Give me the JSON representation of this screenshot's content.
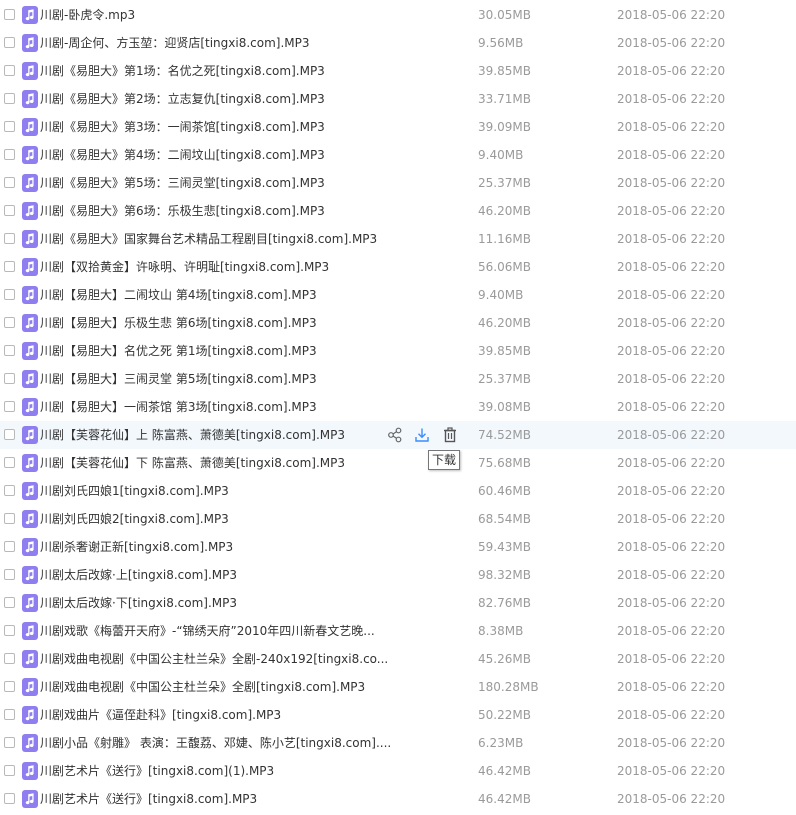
{
  "colors": {
    "file_icon": "#8f7ef0",
    "hover_row": "#f3f8fd",
    "muted_text": "#9a9a9a",
    "accent": "#3b8cff"
  },
  "files": [
    {
      "name": "川剧-卧虎令.mp3",
      "size": "30.05MB",
      "date": "2018-05-06 22:20",
      "icon": "music-file-icon"
    },
    {
      "name": "川剧-周企何、方玉堃：迎贤店[tingxi8.com].MP3",
      "size": "9.56MB",
      "date": "2018-05-06 22:20",
      "icon": "music-file-icon"
    },
    {
      "name": "川剧《易胆大》第1场：名优之死[tingxi8.com].MP3",
      "size": "39.85MB",
      "date": "2018-05-06 22:20",
      "icon": "music-file-icon"
    },
    {
      "name": "川剧《易胆大》第2场：立志复仇[tingxi8.com].MP3",
      "size": "33.71MB",
      "date": "2018-05-06 22:20",
      "icon": "music-file-icon"
    },
    {
      "name": "川剧《易胆大》第3场：一闹茶馆[tingxi8.com].MP3",
      "size": "39.09MB",
      "date": "2018-05-06 22:20",
      "icon": "music-file-icon"
    },
    {
      "name": "川剧《易胆大》第4场：二闹坟山[tingxi8.com].MP3",
      "size": "9.40MB",
      "date": "2018-05-06 22:20",
      "icon": "music-file-icon"
    },
    {
      "name": "川剧《易胆大》第5场：三闹灵堂[tingxi8.com].MP3",
      "size": "25.37MB",
      "date": "2018-05-06 22:20",
      "icon": "music-file-icon"
    },
    {
      "name": "川剧《易胆大》第6场：乐极生悲[tingxi8.com].MP3",
      "size": "46.20MB",
      "date": "2018-05-06 22:20",
      "icon": "music-file-icon"
    },
    {
      "name": "川剧《易胆大》国家舞台艺术精品工程剧目[tingxi8.com].MP3",
      "size": "11.16MB",
      "date": "2018-05-06 22:20",
      "icon": "music-file-icon"
    },
    {
      "name": "川剧【双拾黄金】许咏明、许明耻[tingxi8.com].MP3",
      "size": "56.06MB",
      "date": "2018-05-06 22:20",
      "icon": "music-file-icon"
    },
    {
      "name": "川剧【易胆大】二闹坟山 第4场[tingxi8.com].MP3",
      "size": "9.40MB",
      "date": "2018-05-06 22:20",
      "icon": "music-file-icon"
    },
    {
      "name": "川剧【易胆大】乐极生悲 第6场[tingxi8.com].MP3",
      "size": "46.20MB",
      "date": "2018-05-06 22:20",
      "icon": "music-file-icon"
    },
    {
      "name": "川剧【易胆大】名优之死 第1场[tingxi8.com].MP3",
      "size": "39.85MB",
      "date": "2018-05-06 22:20",
      "icon": "music-file-icon"
    },
    {
      "name": "川剧【易胆大】三闹灵堂 第5场[tingxi8.com].MP3",
      "size": "25.37MB",
      "date": "2018-05-06 22:20",
      "icon": "music-file-icon"
    },
    {
      "name": "川剧【易胆大】一闹茶馆 第3场[tingxi8.com].MP3",
      "size": "39.08MB",
      "date": "2018-05-06 22:20",
      "icon": "music-file-icon"
    },
    {
      "name": "川剧【芙蓉花仙】上 陈富燕、萧德美[tingxi8.com].MP3",
      "size": "74.52MB",
      "date": "2018-05-06 22:20",
      "icon": "music-file-icon"
    },
    {
      "name": "川剧【芙蓉花仙】下 陈富燕、萧德美[tingxi8.com].MP3",
      "size": "75.68MB",
      "date": "2018-05-06 22:20",
      "icon": "music-file-icon"
    },
    {
      "name": "川剧刘氏四娘1[tingxi8.com].MP3",
      "size": "60.46MB",
      "date": "2018-05-06 22:20",
      "icon": "music-file-icon"
    },
    {
      "name": "川剧刘氏四娘2[tingxi8.com].MP3",
      "size": "68.54MB",
      "date": "2018-05-06 22:20",
      "icon": "music-file-icon"
    },
    {
      "name": "川剧杀奢谢正新[tingxi8.com].MP3",
      "size": "59.43MB",
      "date": "2018-05-06 22:20",
      "icon": "music-file-icon"
    },
    {
      "name": "川剧太后改嫁·上[tingxi8.com].MP3",
      "size": "98.32MB",
      "date": "2018-05-06 22:20",
      "icon": "music-file-icon"
    },
    {
      "name": "川剧太后改嫁·下[tingxi8.com].MP3",
      "size": "82.76MB",
      "date": "2018-05-06 22:20",
      "icon": "music-file-icon"
    },
    {
      "name": "川剧戏歌《梅蕾开天府》-“锦绣天府”2010年四川新春文艺晚...",
      "size": "8.38MB",
      "date": "2018-05-06 22:20",
      "icon": "music-file-icon"
    },
    {
      "name": "川剧戏曲电视剧《中国公主杜兰朵》全剧-240x192[tingxi8.co...",
      "size": "45.26MB",
      "date": "2018-05-06 22:20",
      "icon": "music-file-icon"
    },
    {
      "name": "川剧戏曲电视剧《中国公主杜兰朵》全剧[tingxi8.com].MP3",
      "size": "180.28MB",
      "date": "2018-05-06 22:20",
      "icon": "music-file-icon"
    },
    {
      "name": "川剧戏曲片《逼侄赴科》[tingxi8.com].MP3",
      "size": "50.22MB",
      "date": "2018-05-06 22:20",
      "icon": "music-file-icon"
    },
    {
      "name": "川剧小品《射雕》 表演：王馥荔、邓婕、陈小艺[tingxi8.com]....",
      "size": "6.23MB",
      "date": "2018-05-06 22:20",
      "icon": "music-file-icon"
    },
    {
      "name": "川剧艺术片《送行》[tingxi8.com](1).MP3",
      "size": "46.42MB",
      "date": "2018-05-06 22:20",
      "icon": "music-file-icon"
    },
    {
      "name": "川剧艺术片《送行》[tingxi8.com].MP3",
      "size": "46.42MB",
      "date": "2018-05-06 22:20",
      "icon": "music-file-icon"
    }
  ],
  "hovered_row": {
    "index": 15,
    "actions": [
      {
        "name": "share",
        "icon": "share-icon"
      },
      {
        "name": "download",
        "icon": "download-icon"
      },
      {
        "name": "delete",
        "icon": "trash-icon"
      }
    ],
    "tooltip": "下载"
  }
}
